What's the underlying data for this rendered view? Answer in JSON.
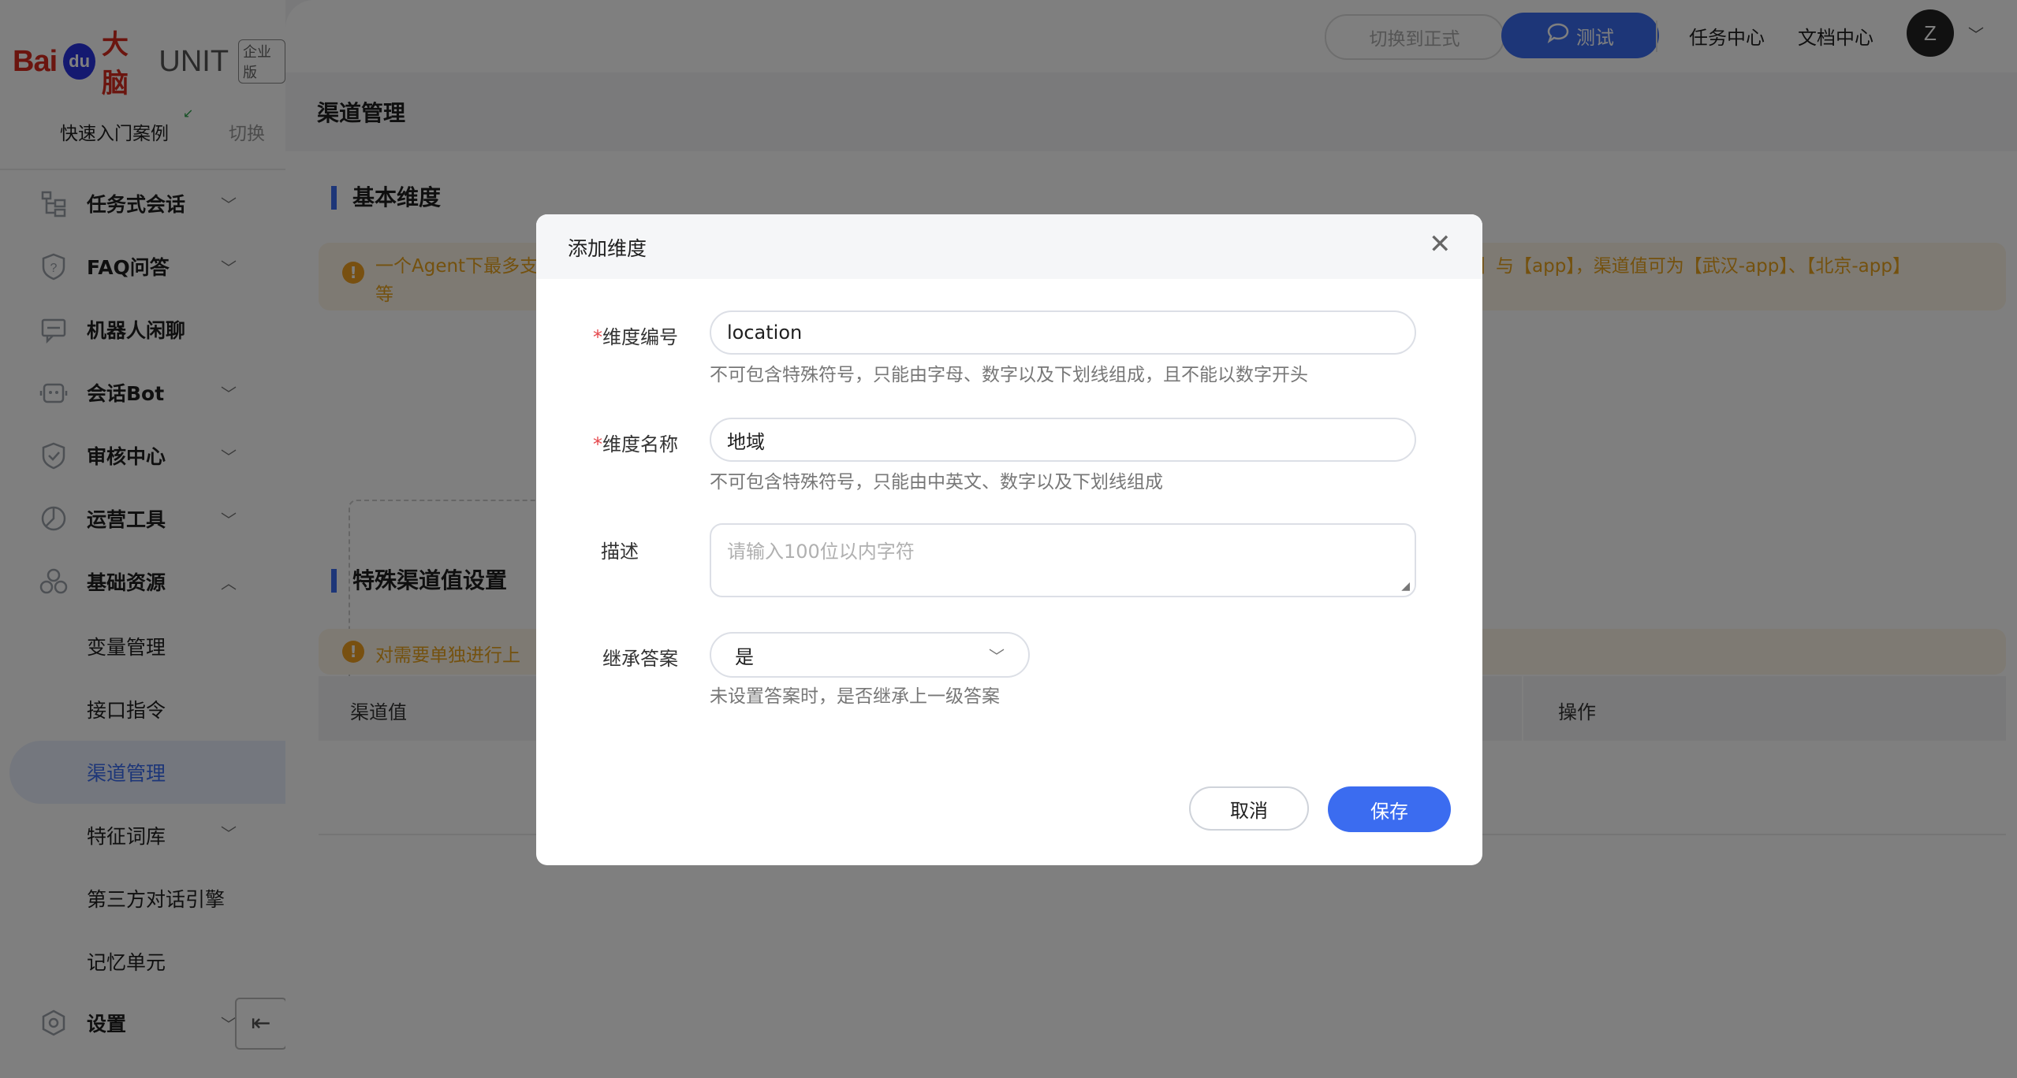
{
  "brand": {
    "bai": "Bai",
    "du": "du",
    "danao": "大脑",
    "unit": "UNIT",
    "edition": "企业版"
  },
  "sidebar": {
    "quick_start": "快速入门案例",
    "switch": "切换",
    "items": [
      {
        "label": "任务式会话",
        "icon": "task-flow-icon"
      },
      {
        "label": "FAQ问答",
        "icon": "faq-icon"
      },
      {
        "label": "机器人闲聊",
        "icon": "chat-icon"
      },
      {
        "label": "会话Bot",
        "icon": "bot-icon"
      },
      {
        "label": "审核中心",
        "icon": "shield-icon"
      },
      {
        "label": "运营工具",
        "icon": "pie-icon"
      },
      {
        "label": "基础资源",
        "icon": "resource-icon"
      }
    ],
    "subitems": [
      {
        "label": "变量管理"
      },
      {
        "label": "接口指令"
      },
      {
        "label": "渠道管理"
      },
      {
        "label": "特征词库"
      },
      {
        "label": "第三方对话引擎"
      },
      {
        "label": "记忆单元"
      }
    ],
    "settings": {
      "label": "设置",
      "icon": "gear-icon"
    }
  },
  "topbar": {
    "switch_formal": "切换到正式",
    "test": "测试",
    "task_center": "任务中心",
    "doc_center": "文档中心",
    "avatar_initial": "Z"
  },
  "page": {
    "title": "渠道管理",
    "basic_section": "基本维度",
    "basic_alert_left": "一个Agent下最多支",
    "basic_alert_right": "】与【app】，渠道值可为【武汉-app】、【北京-app】",
    "basic_alert_line2": "等",
    "special_section": "特殊渠道值设置",
    "special_alert": "对需要单独进行上",
    "table_headers": {
      "channel_value": "渠道值",
      "operation": "操作"
    }
  },
  "modal": {
    "title": "添加维度",
    "fields": {
      "code": {
        "label": "维度编号",
        "value": "location",
        "hint": "不可包含特殊符号，只能由字母、数字以及下划线组成，且不能以数字开头"
      },
      "name": {
        "label": "维度名称",
        "value": "地域",
        "hint": "不可包含特殊符号，只能由中英文、数字以及下划线组成"
      },
      "desc": {
        "label": "描述",
        "placeholder": "请输入100位以内字符"
      },
      "inherit": {
        "label": "继承答案",
        "value": "是",
        "hint": "未设置答案时，是否继承上一级答案"
      }
    },
    "required_mark": "*",
    "cancel": "取消",
    "save": "保存"
  },
  "colors": {
    "primary": "#3b6cf0",
    "warning": "#e8a21c",
    "required": "#e5484d",
    "brand_red": "#d62b1e"
  }
}
